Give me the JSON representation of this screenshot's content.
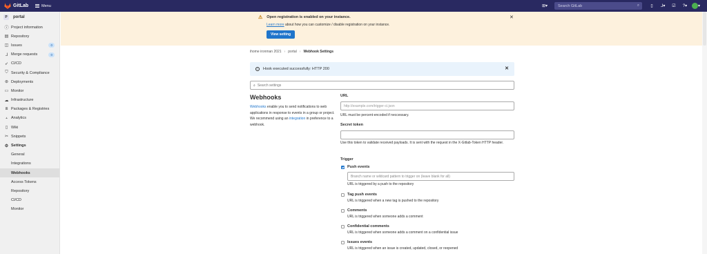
{
  "topbar": {
    "brand": "GitLab",
    "menu_label": "Menu",
    "search_placeholder": "Search GitLab"
  },
  "sidebar": {
    "project_initial": "P",
    "project_name": "portal",
    "items": [
      {
        "label": "Project information",
        "icon": "info-icon"
      },
      {
        "label": "Repository",
        "icon": "doc-icon"
      },
      {
        "label": "Issues",
        "icon": "issues-icon",
        "count": "0"
      },
      {
        "label": "Merge requests",
        "icon": "merge-icon",
        "count": "0"
      },
      {
        "label": "CI/CD",
        "icon": "rocket-icon"
      },
      {
        "label": "Security & Compliance",
        "icon": "shield-icon"
      },
      {
        "label": "Deployments",
        "icon": "deploy-icon"
      },
      {
        "label": "Monitor",
        "icon": "monitor-icon"
      },
      {
        "label": "Infrastructure",
        "icon": "cloud-icon"
      },
      {
        "label": "Packages & Registries",
        "icon": "package-icon"
      },
      {
        "label": "Analytics",
        "icon": "chart-icon"
      },
      {
        "label": "Wiki",
        "icon": "book-icon"
      },
      {
        "label": "Snippets",
        "icon": "scissors-icon"
      },
      {
        "label": "Settings",
        "icon": "gear-icon"
      }
    ],
    "settings_sub": [
      "General",
      "Integrations",
      "Webhooks",
      "Access Tokens",
      "Repository",
      "CI/CD",
      "Monitor"
    ]
  },
  "banner": {
    "title": "Open registration is enabled on your instance.",
    "link": "Learn more",
    "text": " about how you can customize / disable registration on your instance.",
    "button": "View setting"
  },
  "breadcrumb": {
    "group": "ihome ironman 2021",
    "project": "portal",
    "current": "Webhook Settings"
  },
  "flash": {
    "message": "Hook executed successfully: HTTP 200"
  },
  "search_settings": {
    "placeholder": "Search settings"
  },
  "webhooks": {
    "title": "Webhooks",
    "desc_link1": "Webhooks",
    "desc_text1": " enable you to send notifications to web applications in response to events in a group or project. We recommend using an ",
    "desc_link2": "integration",
    "desc_text2": " in preference to a webhook."
  },
  "form": {
    "url_label": "URL",
    "url_placeholder": "http://example.com/trigger-ci.json",
    "url_help": "URL must be percent-encoded if neccessary.",
    "secret_label": "Secret token",
    "secret_value": "",
    "secret_help": "Use this token to validate received payloads. It is sent with the request in the X-Gitlab-Token HTTP header.",
    "trigger_label": "Trigger",
    "branch_placeholder": "Branch name or wildcard pattern to trigger on (leave blank for all)",
    "triggers": [
      {
        "label": "Push events",
        "help": "URL is triggered by a push to the repository",
        "checked": true
      },
      {
        "label": "Tag push events",
        "help": "URL is triggered when a new tag is pushed to the repository",
        "checked": false
      },
      {
        "label": "Comments",
        "help": "URL is triggered when someone adds a comment",
        "checked": false
      },
      {
        "label": "Confidential comments",
        "help": "URL is triggered when someone adds a comment on a confidential issue",
        "checked": false
      },
      {
        "label": "Issues events",
        "help": "URL is triggered when an issue is created, updated, closed, or reopened",
        "checked": false
      }
    ]
  }
}
